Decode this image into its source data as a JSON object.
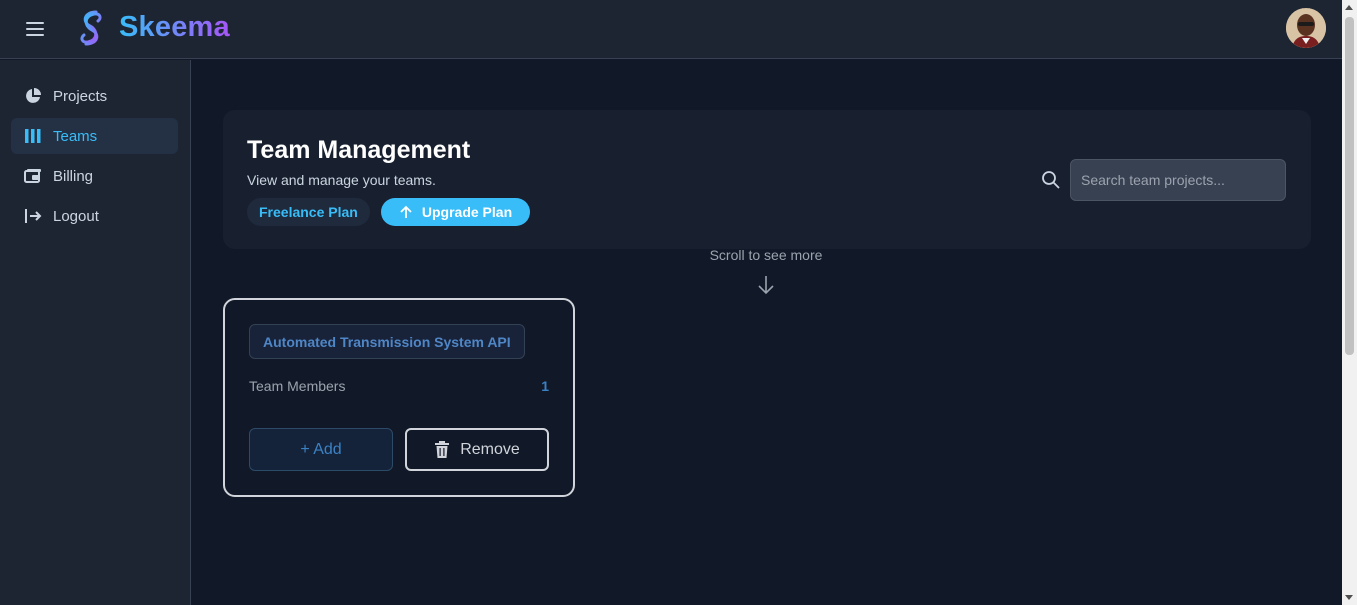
{
  "app": {
    "name": "Skeema"
  },
  "sidebar": {
    "items": [
      {
        "label": "Projects",
        "icon": "pie-chart-icon"
      },
      {
        "label": "Teams",
        "icon": "columns-icon",
        "active": true
      },
      {
        "label": "Billing",
        "icon": "wallet-icon"
      },
      {
        "label": "Logout",
        "icon": "logout-icon"
      }
    ]
  },
  "header": {
    "title": "Team Management",
    "subtitle": "View and manage your teams.",
    "plan": "Freelance Plan",
    "upgrade_label": "Upgrade Plan",
    "search_placeholder": "Search team projects..."
  },
  "scroll_hint": "Scroll to see more",
  "teams": [
    {
      "project": "Automated Transmission System API",
      "members_label": "Team Members",
      "members_count": "1",
      "add_label": "+ Add",
      "remove_label": "Remove"
    }
  ],
  "colors": {
    "accent": "#38bdf8",
    "brand_gradient_end": "#a855f7",
    "background": "#111827",
    "panel": "#1e2532"
  }
}
